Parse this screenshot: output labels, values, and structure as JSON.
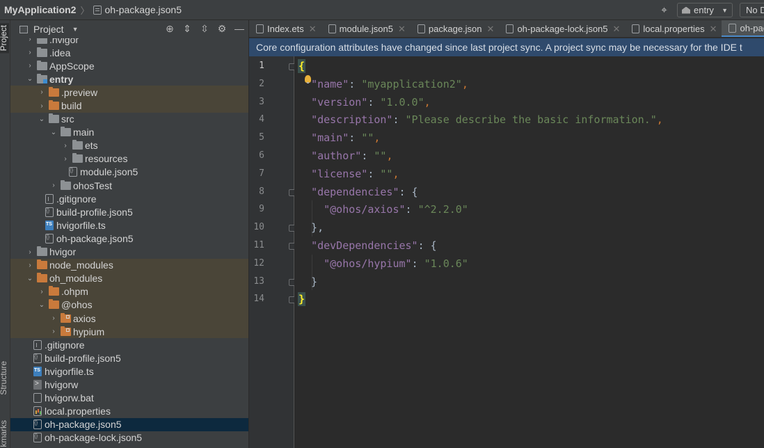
{
  "topbar": {
    "project_name": "MyApplication2",
    "separator": "〉",
    "current_file": "oh-package.json5",
    "run_config": "entry",
    "device": "No D"
  },
  "left_stripe": {
    "project_tab": "Project",
    "structure_tab": "Structure",
    "bookmarks_tab": "kmarks"
  },
  "project_panel": {
    "title": "Project",
    "tree": [
      {
        "label": ".hvigor",
        "icon": "folder",
        "color": "grey",
        "chevron": "›",
        "indent": 0,
        "state": ""
      },
      {
        "label": ".idea",
        "icon": "folder",
        "color": "grey",
        "chevron": "›",
        "indent": 0,
        "state": ""
      },
      {
        "label": "AppScope",
        "icon": "folder",
        "color": "grey",
        "chevron": "›",
        "indent": 0,
        "state": ""
      },
      {
        "label": "entry",
        "icon": "module-folder",
        "color": "grey",
        "chevron": "⌄",
        "indent": 0,
        "state": "",
        "bold": true
      },
      {
        "label": ".preview",
        "icon": "folder",
        "color": "orange",
        "chevron": "›",
        "indent": 1,
        "state": "excluded"
      },
      {
        "label": "build",
        "icon": "folder",
        "color": "orange",
        "chevron": "›",
        "indent": 1,
        "state": "excluded"
      },
      {
        "label": "src",
        "icon": "folder",
        "color": "grey",
        "chevron": "⌄",
        "indent": 1,
        "state": ""
      },
      {
        "label": "main",
        "icon": "folder",
        "color": "grey",
        "chevron": "⌄",
        "indent": 2,
        "state": ""
      },
      {
        "label": "ets",
        "icon": "folder",
        "color": "grey",
        "chevron": "›",
        "indent": 3,
        "state": ""
      },
      {
        "label": "resources",
        "icon": "folder",
        "color": "grey",
        "chevron": "›",
        "indent": 3,
        "state": ""
      },
      {
        "label": "module.json5",
        "icon": "json",
        "chevron": "",
        "indent": 3,
        "state": ""
      },
      {
        "label": "ohosTest",
        "icon": "folder",
        "color": "grey",
        "chevron": "›",
        "indent": 2,
        "state": ""
      },
      {
        "label": ".gitignore",
        "icon": "git",
        "chevron": "",
        "indent": 1,
        "state": ""
      },
      {
        "label": "build-profile.json5",
        "icon": "json",
        "chevron": "",
        "indent": 1,
        "state": ""
      },
      {
        "label": "hvigorfile.ts",
        "icon": "ts",
        "chevron": "",
        "indent": 1,
        "state": ""
      },
      {
        "label": "oh-package.json5",
        "icon": "json",
        "chevron": "",
        "indent": 1,
        "state": ""
      },
      {
        "label": "hvigor",
        "icon": "folder",
        "color": "grey",
        "chevron": "›",
        "indent": 0,
        "state": ""
      },
      {
        "label": "node_modules",
        "icon": "folder",
        "color": "orange",
        "chevron": "›",
        "indent": 0,
        "state": "excluded"
      },
      {
        "label": "oh_modules",
        "icon": "folder",
        "color": "orange",
        "chevron": "⌄",
        "indent": 0,
        "state": "excluded"
      },
      {
        "label": ".ohpm",
        "icon": "folder",
        "color": "orange",
        "chevron": "›",
        "indent": 1,
        "state": "excluded"
      },
      {
        "label": "@ohos",
        "icon": "folder",
        "color": "orange",
        "chevron": "⌄",
        "indent": 1,
        "state": "excluded"
      },
      {
        "label": "axios",
        "icon": "lib-folder",
        "color": "orange",
        "chevron": "›",
        "indent": 2,
        "state": "excluded"
      },
      {
        "label": "hypium",
        "icon": "lib-folder",
        "color": "orange",
        "chevron": "›",
        "indent": 2,
        "state": "excluded"
      },
      {
        "label": ".gitignore",
        "icon": "git",
        "chevron": "",
        "indent": 0,
        "state": ""
      },
      {
        "label": "build-profile.json5",
        "icon": "json",
        "chevron": "",
        "indent": 0,
        "state": ""
      },
      {
        "label": "hvigorfile.ts",
        "icon": "ts",
        "chevron": "",
        "indent": 0,
        "state": ""
      },
      {
        "label": "hvigorw",
        "icon": "sh",
        "chevron": "",
        "indent": 0,
        "state": ""
      },
      {
        "label": "hvigorw.bat",
        "icon": "bat",
        "chevron": "",
        "indent": 0,
        "state": ""
      },
      {
        "label": "local.properties",
        "icon": "prop",
        "chevron": "",
        "indent": 0,
        "state": ""
      },
      {
        "label": "oh-package.json5",
        "icon": "json",
        "chevron": "",
        "indent": 0,
        "state": "selected"
      },
      {
        "label": "oh-package-lock.json5",
        "icon": "json",
        "chevron": "",
        "indent": 0,
        "state": ""
      }
    ]
  },
  "editor": {
    "tabs": [
      {
        "label": "Index.ets",
        "active": false
      },
      {
        "label": "module.json5",
        "active": false
      },
      {
        "label": "package.json",
        "active": false
      },
      {
        "label": "oh-package-lock.json5",
        "active": false
      },
      {
        "label": "local.properties",
        "active": false
      },
      {
        "label": "oh-package",
        "active": true
      }
    ],
    "banner": "Core configuration attributes have changed since last project sync. A project sync may be necessary for the IDE t",
    "line_numbers": [
      "1",
      "2",
      "3",
      "4",
      "5",
      "6",
      "7",
      "8",
      "9",
      "10",
      "11",
      "12",
      "13",
      "14"
    ],
    "code_lines": [
      [
        {
          "t": "{",
          "c": "brace-hl"
        }
      ],
      [
        {
          "t": "  "
        },
        {
          "t": "\"name\"",
          "c": "k"
        },
        {
          "t": ": "
        },
        {
          "t": "\"myapplication2\"",
          "c": "s"
        },
        {
          "t": ",",
          "c": "p"
        }
      ],
      [
        {
          "t": "  "
        },
        {
          "t": "\"version\"",
          "c": "k"
        },
        {
          "t": ": "
        },
        {
          "t": "\"1.0.0\"",
          "c": "s"
        },
        {
          "t": ",",
          "c": "p"
        }
      ],
      [
        {
          "t": "  "
        },
        {
          "t": "\"description\"",
          "c": "k"
        },
        {
          "t": ": "
        },
        {
          "t": "\"Please describe the basic information.\"",
          "c": "s"
        },
        {
          "t": ",",
          "c": "p"
        }
      ],
      [
        {
          "t": "  "
        },
        {
          "t": "\"main\"",
          "c": "k"
        },
        {
          "t": ": "
        },
        {
          "t": "\"\"",
          "c": "s"
        },
        {
          "t": ",",
          "c": "p"
        }
      ],
      [
        {
          "t": "  "
        },
        {
          "t": "\"author\"",
          "c": "k"
        },
        {
          "t": ": "
        },
        {
          "t": "\"\"",
          "c": "s"
        },
        {
          "t": ",",
          "c": "p"
        }
      ],
      [
        {
          "t": "  "
        },
        {
          "t": "\"license\"",
          "c": "k"
        },
        {
          "t": ": "
        },
        {
          "t": "\"\"",
          "c": "s"
        },
        {
          "t": ",",
          "c": "p"
        }
      ],
      [
        {
          "t": "  "
        },
        {
          "t": "\"dependencies\"",
          "c": "k"
        },
        {
          "t": ": {"
        }
      ],
      [
        {
          "t": "    "
        },
        {
          "t": "\"@ohos/axios\"",
          "c": "k"
        },
        {
          "t": ": "
        },
        {
          "t": "\"^2.2.0\"",
          "c": "s"
        }
      ],
      [
        {
          "t": "  },"
        }
      ],
      [
        {
          "t": "  "
        },
        {
          "t": "\"devDependencies\"",
          "c": "k"
        },
        {
          "t": ": {"
        }
      ],
      [
        {
          "t": "    "
        },
        {
          "t": "\"@ohos/hypium\"",
          "c": "k"
        },
        {
          "t": ": "
        },
        {
          "t": "\"1.0.6\"",
          "c": "s"
        }
      ],
      [
        {
          "t": "  }"
        }
      ],
      [
        {
          "t": "}",
          "c": "brace-hl"
        }
      ]
    ]
  },
  "colors": {
    "accent": "#4a88c7",
    "banner_bg": "#2f4a6c",
    "excluded_bg": "#4a4538",
    "selected_bg": "#0d293e",
    "json_key": "#9876aa",
    "json_string": "#6a8759"
  }
}
